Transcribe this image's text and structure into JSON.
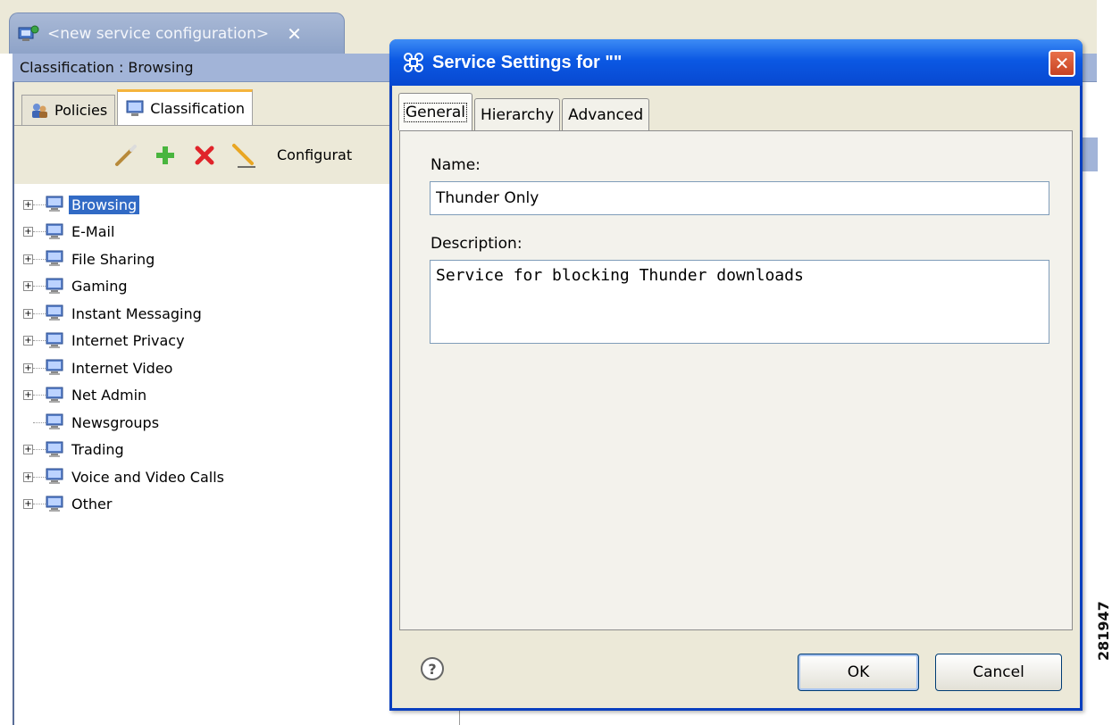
{
  "editor": {
    "tab_title": "<new service configuration>",
    "tab_close": "✕",
    "view_header": "Classification : Browsing",
    "subtabs": [
      {
        "label": "Policies"
      },
      {
        "label": "Classification"
      }
    ],
    "toolbar_label": "Configurat"
  },
  "tree": {
    "items": [
      {
        "label": "Browsing",
        "expandable": true,
        "selected": true
      },
      {
        "label": "E-Mail",
        "expandable": true
      },
      {
        "label": "File Sharing",
        "expandable": true
      },
      {
        "label": "Gaming",
        "expandable": true
      },
      {
        "label": "Instant Messaging",
        "expandable": true
      },
      {
        "label": "Internet Privacy",
        "expandable": true
      },
      {
        "label": "Internet Video",
        "expandable": true
      },
      {
        "label": "Net Admin",
        "expandable": true
      },
      {
        "label": "Newsgroups",
        "expandable": false
      },
      {
        "label": "Trading",
        "expandable": true
      },
      {
        "label": "Voice and Video Calls",
        "expandable": true
      },
      {
        "label": "Other",
        "expandable": true
      }
    ]
  },
  "dialog": {
    "title": "Service Settings for \"\"",
    "close_glyph": "✕",
    "tabs": [
      {
        "label": "General"
      },
      {
        "label": "Hierarchy"
      },
      {
        "label": "Advanced"
      }
    ],
    "name_label": "Name:",
    "name_value": "Thunder Only",
    "description_label": "Description:",
    "description_value": "Service for blocking Thunder downloads",
    "help_glyph": "?",
    "ok_label": "OK",
    "cancel_label": "Cancel"
  },
  "figure_id": "281947",
  "colors": {
    "selection": "#316ac5",
    "dialog_title_bar": "#0b58e3",
    "view_header": "#a2b4d8",
    "dialog_face": "#ece9d8"
  }
}
